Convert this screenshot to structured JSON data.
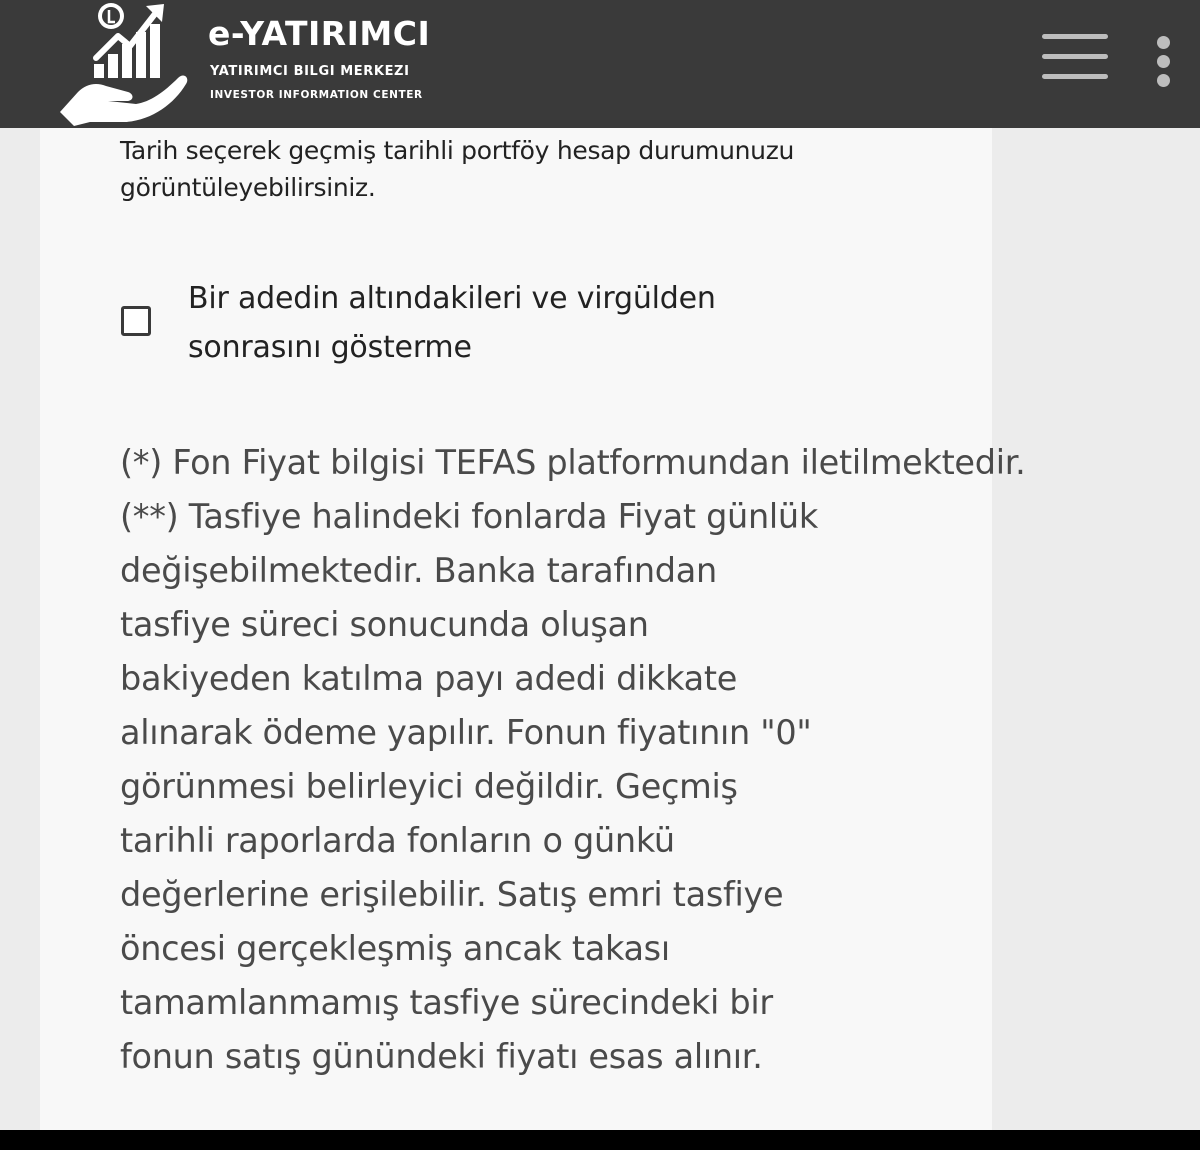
{
  "header": {
    "brand_title": "e-YATIRIMCI",
    "brand_subtitle": "YATIRIMCI BILGI MERKEZI",
    "brand_subtitle_en": "INVESTOR INFORMATION CENTER",
    "menu_icon": "hamburger-menu-icon",
    "more_icon": "vertical-dots-icon"
  },
  "content": {
    "intro_line1": "Tarih seçerek geçmiş tarihli portföy hesap durumunuzu",
    "intro_line2": "görüntüleyebilirsiniz.",
    "checkbox": {
      "label_line1": "Bir adedin altındakileri ve virgülden",
      "label_line2": "sonrasını gösterme",
      "checked": false
    },
    "note1": "(*) Fon Fiyat bilgisi TEFAS platformundan iletilmektedir.",
    "note2_lines": [
      "(**) Tasfiye halindeki fonlarda Fiyat günlük",
      "değişebilmektedir. Banka tarafından",
      "tasfiye süreci sonucunda oluşan",
      "bakiyeden katılma payı adedi dikkate",
      "alınarak ödeme yapılır. Fonun fiyatının \"0\"",
      "görünmesi belirleyici değildir. Geçmiş",
      "tarihli raporlarda fonların o günkü",
      "değerlerine erişilebilir. Satış emri tasfiye",
      "öncesi gerçekleşmiş ancak takası",
      "tamamlanmamış tasfiye sürecindeki bir",
      "fonun satış günündeki fiyatı esas alınır."
    ]
  },
  "colors": {
    "header_bg": "#3a3a3a",
    "card_bg": "#f8f8f8",
    "page_bg": "#ececec",
    "text_dark": "#222222",
    "text_note": "#4a4a4a"
  }
}
